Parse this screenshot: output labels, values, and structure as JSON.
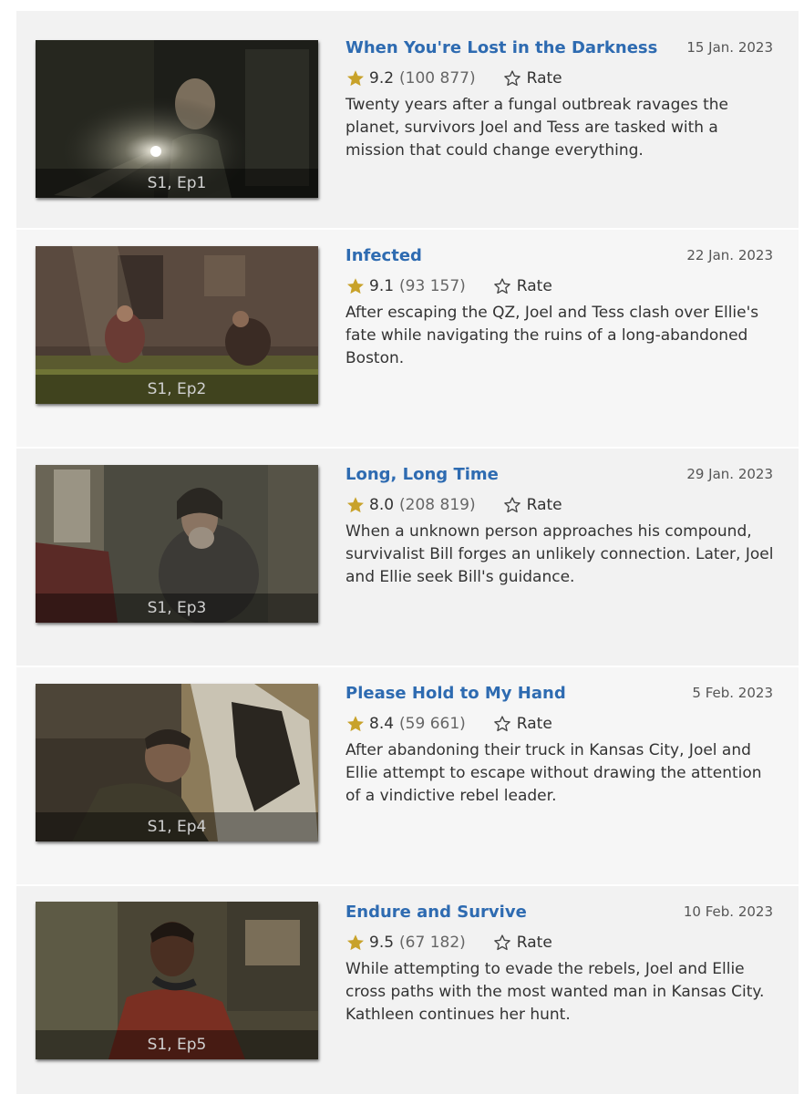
{
  "episodes": [
    {
      "title": "When You're Lost in the Darkness",
      "date": "15 Jan. 2023",
      "rating": "9.2",
      "votes": "(100 877)",
      "rate_label": "Rate",
      "ep_label": "S1, Ep1",
      "description": "Twenty years after a fungal outbreak ravages the planet, survivors Joel and Tess are tasked with a mission that could change everything."
    },
    {
      "title": "Infected",
      "date": "22 Jan. 2023",
      "rating": "9.1",
      "votes": "(93 157)",
      "rate_label": "Rate",
      "ep_label": "S1, Ep2",
      "description": "After escaping the QZ, Joel and Tess clash over Ellie's fate while navigating the ruins of a long-abandoned Boston."
    },
    {
      "title": "Long, Long Time",
      "date": "29 Jan. 2023",
      "rating": "8.0",
      "votes": "(208 819)",
      "rate_label": "Rate",
      "ep_label": "S1, Ep3",
      "description": "When a unknown person approaches his compound, survivalist Bill forges an unlikely connection. Later, Joel and Ellie seek Bill's guidance."
    },
    {
      "title": "Please Hold to My Hand",
      "date": "5 Feb. 2023",
      "rating": "8.4",
      "votes": "(59 661)",
      "rate_label": "Rate",
      "ep_label": "S1, Ep4",
      "description": "After abandoning their truck in Kansas City, Joel and Ellie attempt to escape without drawing the attention of a vindictive rebel leader."
    },
    {
      "title": "Endure and Survive",
      "date": "10 Feb. 2023",
      "rating": "9.5",
      "votes": "(67 182)",
      "rate_label": "Rate",
      "ep_label": "S1, Ep5",
      "description": "While attempting to evade the rebels, Joel and Ellie cross paths with the most wanted man in Kansas City. Kathleen continues her hunt."
    }
  ],
  "colors": {
    "title_link": "#2e6bb1",
    "star_filled": "#c8a22a",
    "row_odd": "#f2f2f2",
    "row_even": "#f6f6f6"
  }
}
